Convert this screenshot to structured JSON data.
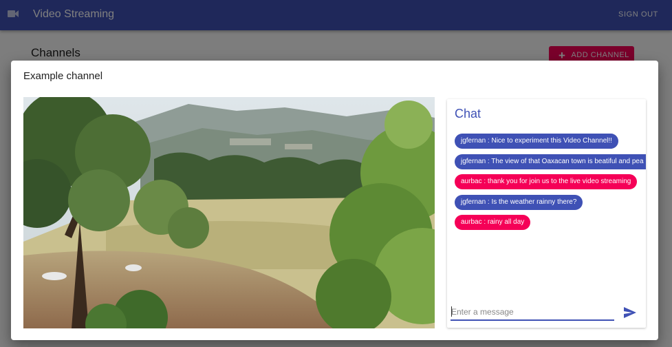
{
  "app": {
    "title": "Video Streaming",
    "sign_out": "SIGN OUT",
    "camera_icon": "videocam-icon",
    "primary_color": "#3f51b5",
    "accent_color": "#f50057"
  },
  "background": {
    "section_title": "Channels",
    "add_channel_label": "ADD CHANNEL",
    "add_icon": "plus-icon"
  },
  "dialog": {
    "title": "Example channel"
  },
  "chat": {
    "title": "Chat",
    "messages": [
      {
        "text": "jgfernan : Nice to experiment this Video Channel!!",
        "color": "blue"
      },
      {
        "text": "jgfernan : The view of that Oaxacan town is beatiful and pea",
        "color": "blue"
      },
      {
        "text": "aurbac : thank you for join us to the live video streaming",
        "color": "pink"
      },
      {
        "text": "jgfernan : Is the weather rainny there?",
        "color": "blue"
      },
      {
        "text": "aurbac : rainy all day",
        "color": "pink"
      }
    ],
    "input_placeholder": "Enter a message",
    "input_value": "",
    "send_icon": "send-icon"
  }
}
